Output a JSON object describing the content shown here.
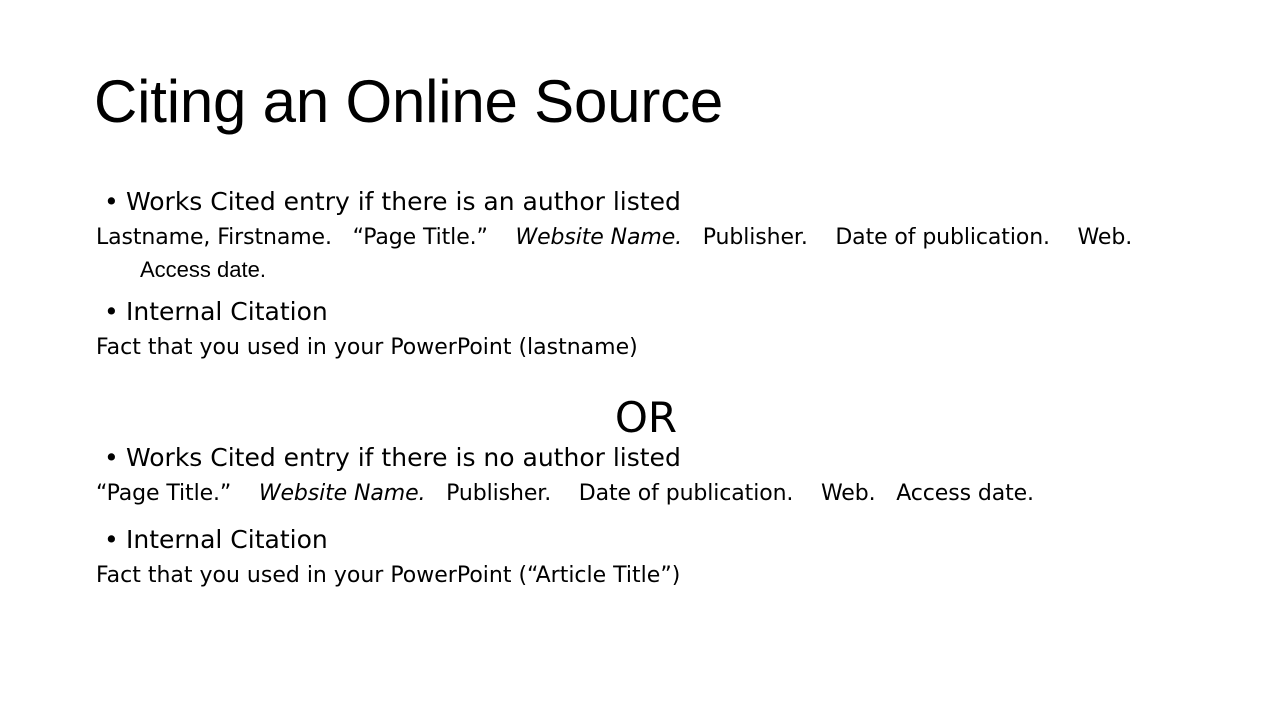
{
  "slide": {
    "title": "Citing an Online Source",
    "background_color": "#ffffff",
    "text_color": "#000000",
    "bullet_glyph": "•",
    "divider_label": "OR",
    "sections": [
      {
        "bullet": "Works Cited entry if there is an author listed",
        "citation": {
          "author": "Lastname, Firstname.",
          "page_title": "“Page Title.”",
          "website_name": "Website Name.",
          "publisher": "Publisher.",
          "date_of_publication": "Date of publication.",
          "medium": "Web.",
          "access_date": "Access date."
        },
        "internal_bullet": "Internal Citation",
        "internal_example": "Fact that you used in your PowerPoint (lastname)"
      },
      {
        "bullet": "Works Cited entry if there is no author listed",
        "citation": {
          "page_title": "“Page Title.”",
          "website_name": "Website Name.",
          "publisher": "Publisher.",
          "date_of_publication": "Date of publication.",
          "medium": "Web.",
          "access_date": "Access date."
        },
        "internal_bullet": "Internal Citation",
        "internal_example": "Fact that you used in your PowerPoint (“Article Title”)"
      }
    ]
  }
}
